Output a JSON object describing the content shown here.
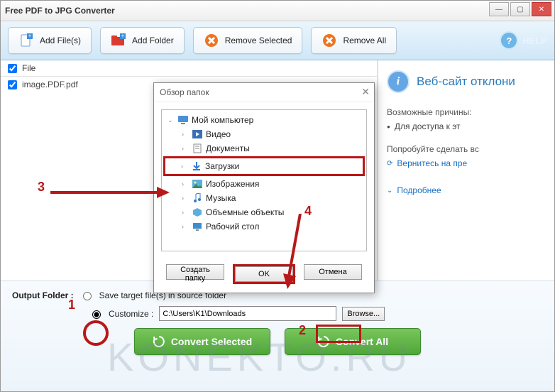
{
  "title": "Free PDF to JPG Converter",
  "toolbar": {
    "add_files": "Add File(s)",
    "add_folder": "Add Folder",
    "remove_selected": "Remove Selected",
    "remove_all": "Remove All",
    "help": "HELP"
  },
  "filelist": {
    "header": "File",
    "items": [
      "image.PDF.pdf"
    ]
  },
  "sidepanel": {
    "heading": "Веб-сайт отклони",
    "reasons_label": "Возможные причины:",
    "reason1": "Для доступа к эт",
    "try_label": "Попробуйте сделать вс",
    "try1": "Вернитесь на пре",
    "more": "Подробнее"
  },
  "output": {
    "label": "Output Folder :",
    "opt_source": "Save target file(s) in source folder",
    "opt_custom": "Customize :",
    "path": "C:\\Users\\K1\\Downloads",
    "browse": "Browse...",
    "convert_selected": "Convert Selected",
    "convert_all": "Convert All"
  },
  "dialog": {
    "title": "Обзор папок",
    "root": "Мой компьютер",
    "nodes": [
      "Видео",
      "Документы",
      "Загрузки",
      "Изображения",
      "Музыка",
      "Объемные объекты",
      "Рабочий стол"
    ],
    "new_folder": "Создать папку",
    "ok": "OK",
    "cancel": "Отмена"
  },
  "annotations": {
    "n1": "1",
    "n2": "2",
    "n3": "3",
    "n4": "4"
  },
  "watermark": "KONEKTO.RU"
}
